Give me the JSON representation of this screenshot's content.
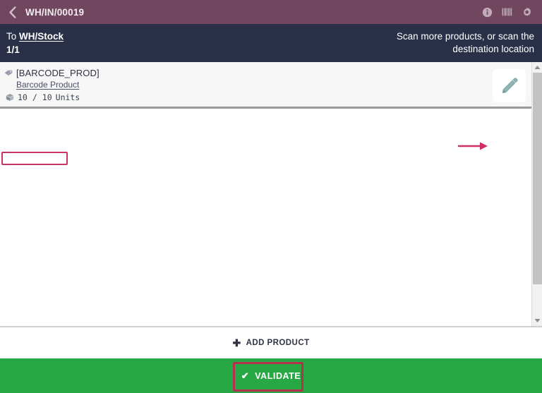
{
  "header": {
    "title": "WH/IN/00019",
    "back_icon": "chevron-left-icon",
    "icons": [
      {
        "name": "info-icon",
        "label": "Information"
      },
      {
        "name": "barcode-icon",
        "label": "Barcode"
      },
      {
        "name": "gear-icon",
        "label": "Settings"
      }
    ]
  },
  "subheader": {
    "to_label": "To",
    "destination": "WH/Stock",
    "counter": "1/1",
    "instruction_line1": "Scan more products, or scan the",
    "instruction_line2": "destination location"
  },
  "product_lines": [
    {
      "code": "[BARCODE_PROD]",
      "name": "Barcode Product",
      "qty_done": "10",
      "qty_separator": "/",
      "qty_demand": "10",
      "uom": "Units",
      "tag_icon": "tag-icon",
      "box_icon": "box-icon",
      "edit_icon": "pencil-icon"
    }
  ],
  "footer": {
    "add_product_label": "ADD PRODUCT",
    "add_product_icon": "plus-icon",
    "validate_label": "VALIDATE",
    "validate_icon": "check-icon"
  },
  "scrollbar": {
    "up_icon": "scroll-up-arrow-icon",
    "down_icon": "scroll-down-arrow-icon"
  },
  "colors": {
    "header_purple": "#71465F",
    "subheader_navy": "#2B3049",
    "validate_green": "#28A745",
    "annotation_pink": "#C8326B",
    "annotation_red": "#B4324F",
    "pencil_teal": "#7FAFAC"
  }
}
